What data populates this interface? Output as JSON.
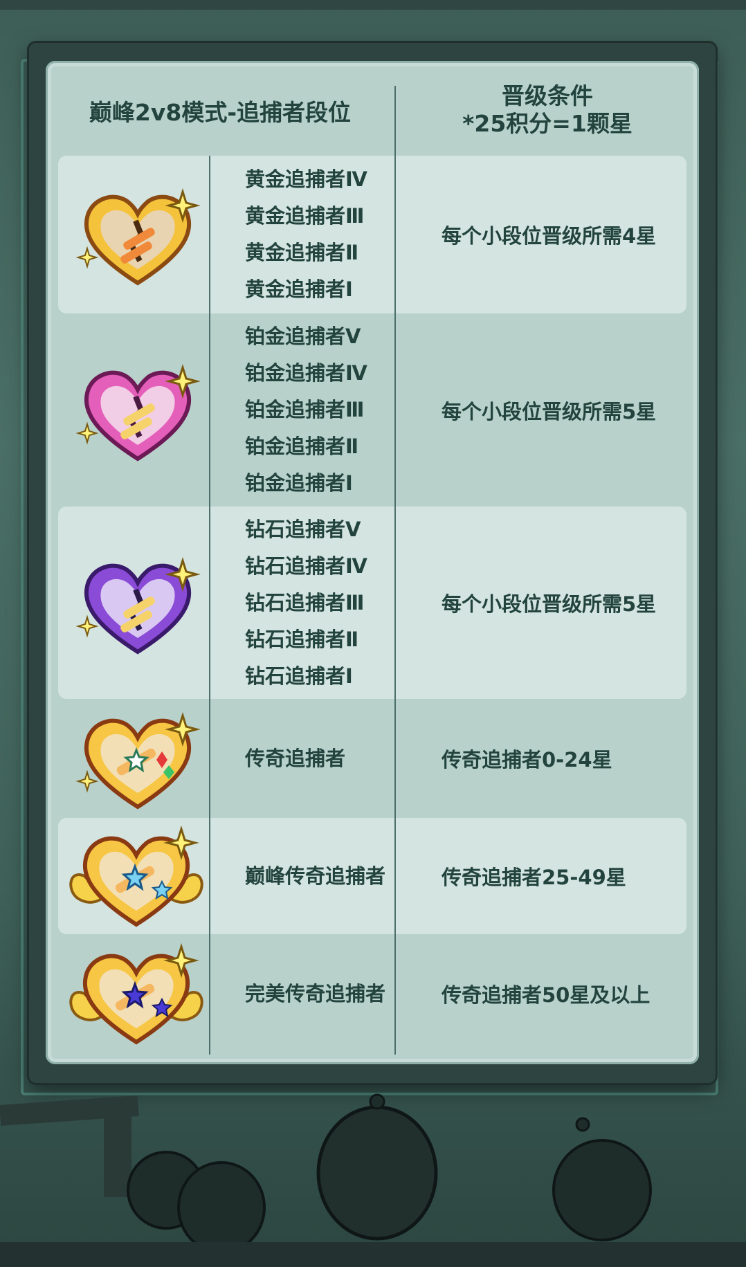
{
  "header": {
    "left_title": "巅峰2v8模式-追捕者段位",
    "right_title": "晋级条件",
    "right_subtitle": "*25积分=1颗星"
  },
  "rows": [
    {
      "badge_icon": "gold-heart-badge-icon",
      "tiers": [
        "黄金追捕者Ⅳ",
        "黄金追捕者Ⅲ",
        "黄金追捕者Ⅱ",
        "黄金追捕者Ⅰ"
      ],
      "condition": "每个小段位晋级所需4星"
    },
    {
      "badge_icon": "platinum-heart-badge-icon",
      "tiers": [
        "铂金追捕者Ⅴ",
        "铂金追捕者Ⅳ",
        "铂金追捕者Ⅲ",
        "铂金追捕者Ⅱ",
        "铂金追捕者Ⅰ"
      ],
      "condition": "每个小段位晋级所需5星"
    },
    {
      "badge_icon": "diamond-heart-badge-icon",
      "tiers": [
        "钻石追捕者Ⅴ",
        "钻石追捕者Ⅳ",
        "钻石追捕者Ⅲ",
        "钻石追捕者Ⅱ",
        "钻石追捕者Ⅰ"
      ],
      "condition": "每个小段位晋级所需5星"
    },
    {
      "badge_icon": "legend-heart-badge-icon",
      "tiers": [
        "传奇追捕者"
      ],
      "condition": "传奇追捕者0-24星"
    },
    {
      "badge_icon": "peak-legend-winged-heart-badge-icon",
      "tiers": [
        "巅峰传奇追捕者"
      ],
      "condition": "传奇追捕者25-49星"
    },
    {
      "badge_icon": "perfect-legend-winged-heart-badge-icon",
      "tiers": [
        "完美传奇追捕者"
      ],
      "condition": "传奇追捕者50星及以上"
    }
  ],
  "colors": {
    "text": "#23443e",
    "panel": "#b8d1cb",
    "row_shade": "#d4e4e0",
    "frame": "#2e4440",
    "gold": "#f2b632",
    "platinum": "#e45fb9",
    "diamond": "#8a4bd6",
    "legend": "#f6c644"
  }
}
